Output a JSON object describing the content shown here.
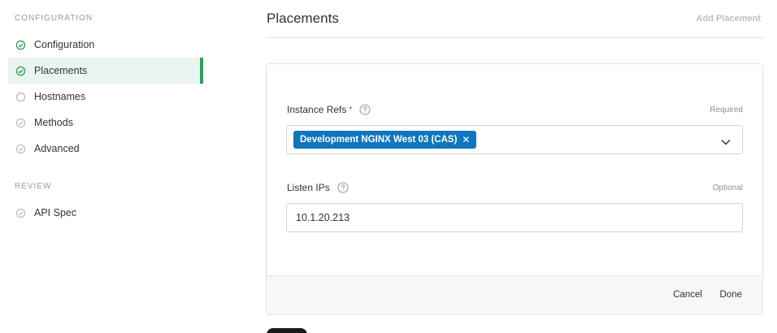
{
  "sidebar": {
    "configuration_section": "CONFIGURATION",
    "review_section": "REVIEW",
    "items": [
      {
        "label": "Configuration",
        "status": "complete"
      },
      {
        "label": "Placements",
        "status": "complete",
        "active": true
      },
      {
        "label": "Hostnames",
        "status": "pending"
      },
      {
        "label": "Methods",
        "status": "optional"
      },
      {
        "label": "Advanced",
        "status": "optional"
      }
    ],
    "review_items": [
      {
        "label": "API Spec",
        "status": "optional"
      }
    ]
  },
  "header": {
    "title": "Placements",
    "add_button": "Add Placement"
  },
  "form": {
    "instance_refs": {
      "label": "Instance Refs",
      "required_mark": "*",
      "hint": "Required",
      "selected": [
        "Development NGINX West 03 (CAS)"
      ]
    },
    "listen_ips": {
      "label": "Listen IPs",
      "hint": "Optional",
      "value": "10.1.20.213"
    },
    "footer": {
      "cancel_label": "Cancel",
      "done_label": "Done"
    }
  },
  "colors": {
    "accent_green": "#2ea05a",
    "active_bg": "#e9f6ef",
    "chip_blue": "#0f76bd"
  }
}
